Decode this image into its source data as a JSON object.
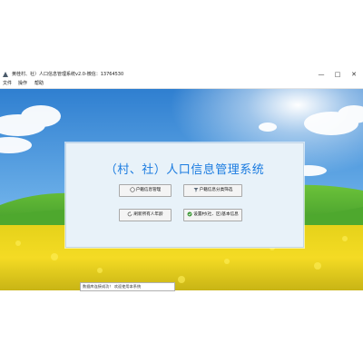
{
  "window": {
    "title": "黄桂村、社）人口信息管理系统v2.0-微信：13764530",
    "minimize_glyph": "—",
    "maximize_glyph": "□",
    "close_glyph": "✕"
  },
  "menu": {
    "items": [
      "文件",
      "操作",
      "帮助"
    ]
  },
  "panel": {
    "title": "（村、社）人口信息管理系统",
    "buttons": [
      {
        "label": "户籍信息管理",
        "icon": "radio-icon"
      },
      {
        "label": "户籍信息分类筛选",
        "icon": "filter-icon"
      },
      {
        "label": "刷新所有人年龄",
        "icon": "refresh-icon"
      },
      {
        "label": "设置村(社、区)基本信息",
        "icon": "settings-icon"
      }
    ]
  },
  "status_bar": {
    "text": "数据库连接成功！ 欢迎使用本系统"
  },
  "colors": {
    "title_blue": "#1a7be0",
    "panel_bg": "#e8f2f9",
    "sky": "#3f8fd9",
    "grass": "#3f9a2c",
    "flowers": "#f1d51c"
  }
}
